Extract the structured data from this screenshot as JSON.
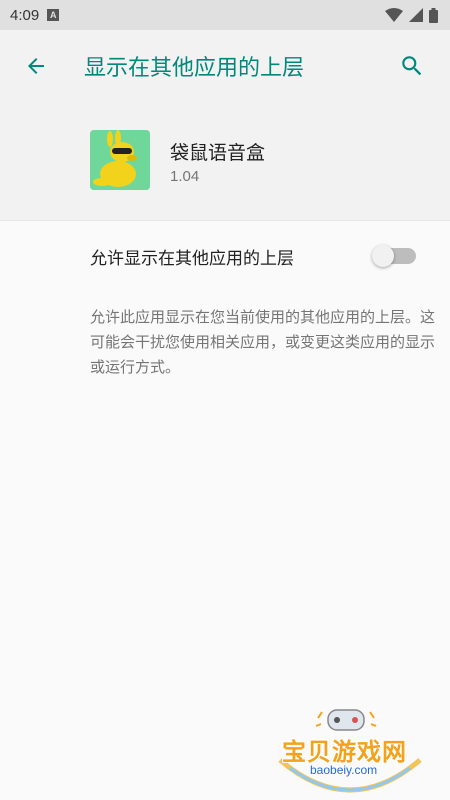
{
  "status_bar": {
    "time": "4:09",
    "notification_letter": "A"
  },
  "app_bar": {
    "title": "显示在其他应用的上层",
    "accent_color": "#00897b"
  },
  "app_info": {
    "name": "袋鼠语音盒",
    "version": "1.04"
  },
  "setting": {
    "label": "允许显示在其他应用的上层",
    "enabled": false
  },
  "description": "允许此应用显示在您当前使用的其他应用的上层。这可能会干扰您使用相关应用，或变更这类应用的显示或运行方式。",
  "watermark": {
    "title": "宝贝游戏网",
    "url": "baobeiy.com"
  },
  "icons": {
    "back": "arrow-back-icon",
    "search": "search-icon",
    "wifi": "wifi-icon",
    "signal": "signal-icon",
    "battery": "battery-icon"
  }
}
